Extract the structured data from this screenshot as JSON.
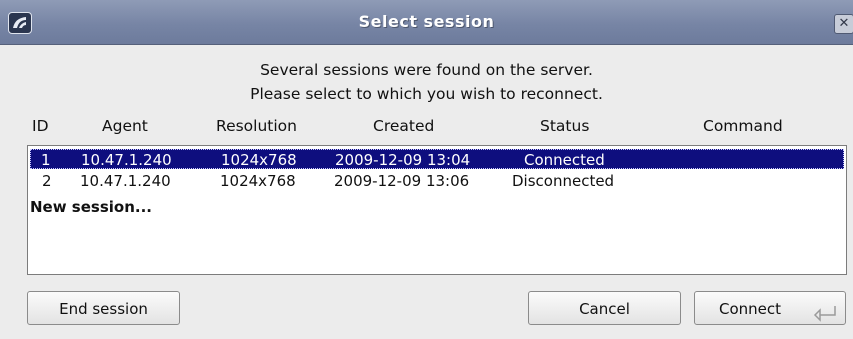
{
  "window": {
    "title": "Select session",
    "close_glyph": "✕"
  },
  "message": {
    "line1": "Several sessions were found on the server.",
    "line2": "Please select to which you wish to reconnect."
  },
  "table": {
    "columns": [
      "ID",
      "Agent",
      "Resolution",
      "Created",
      "Status",
      "Command"
    ],
    "rows": [
      {
        "id": "1",
        "agent": "10.47.1.240",
        "resolution": "1024x768",
        "created": "2009-12-09 13:04",
        "status": "Connected",
        "command": "",
        "selected": true
      },
      {
        "id": "2",
        "agent": "10.47.1.240",
        "resolution": "1024x768",
        "created": "2009-12-09 13:06",
        "status": "Disconnected",
        "command": "",
        "selected": false
      }
    ],
    "new_session_label": "New session..."
  },
  "buttons": {
    "end_session": "End session",
    "cancel": "Cancel",
    "connect": "Connect"
  },
  "icons": {
    "app": "app-logo-icon",
    "close": "close-icon",
    "enter": "enter-key-icon"
  },
  "colors": {
    "titlebar": "#7785a5",
    "selection": "#0e0e7e",
    "window_bg": "#ececec"
  }
}
